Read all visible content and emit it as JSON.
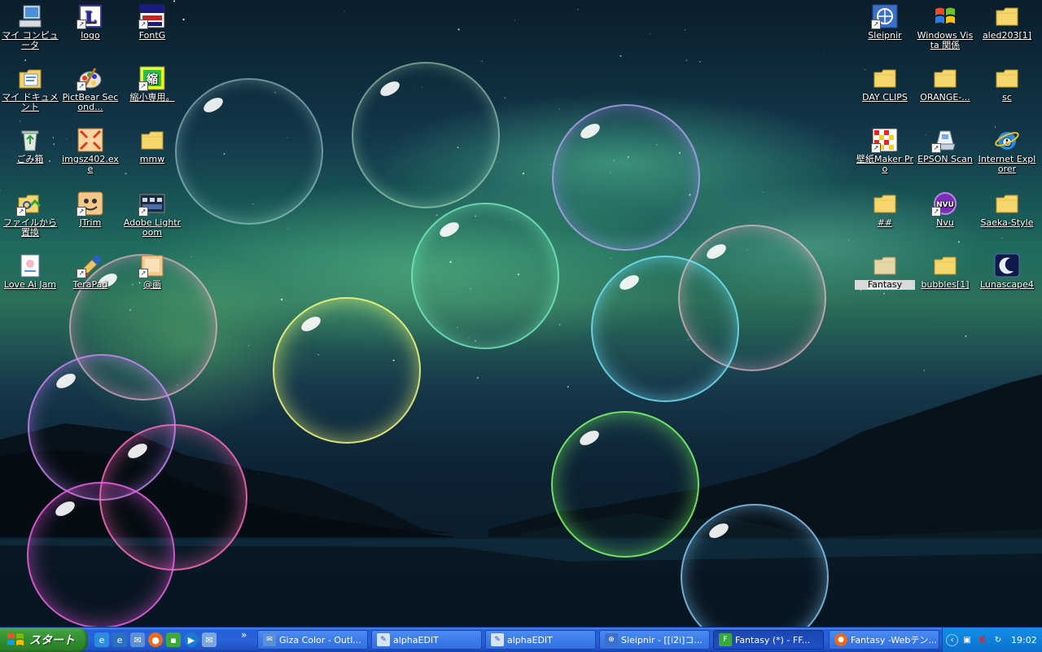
{
  "desktop": {
    "icons_left": [
      {
        "label": "マイ コンピュータ",
        "icon": "my-computer-icon"
      },
      {
        "label": "logo",
        "icon": "logo-file-icon"
      },
      {
        "label": "FontG",
        "icon": "fontg-icon"
      },
      {
        "label": "マイ ドキュメント",
        "icon": "my-documents-icon"
      },
      {
        "label": "PictBear Second...",
        "icon": "pictbear-icon"
      },
      {
        "label": "縮小専用。",
        "icon": "shukusho-icon"
      },
      {
        "label": "ごみ箱",
        "icon": "recycle-bin-icon"
      },
      {
        "label": "imgsz402.exe",
        "icon": "imgsz-icon"
      },
      {
        "label": "mmw",
        "icon": "folder-icon"
      },
      {
        "label": "ファイルから置換",
        "icon": "file-replace-icon"
      },
      {
        "label": "JTrim",
        "icon": "jtrim-icon"
      },
      {
        "label": "Adobe Lightroom",
        "icon": "lightroom-icon"
      },
      {
        "label": "Love Ai Jam",
        "icon": "love-ai-jam-icon"
      },
      {
        "label": "TeraPad",
        "icon": "terapad-icon"
      },
      {
        "label": "@画",
        "icon": "folder-image-icon"
      }
    ],
    "icons_right": [
      {
        "label": "Sleipnir",
        "icon": "sleipnir-icon"
      },
      {
        "label": "Windows Vista 関係",
        "icon": "windows-vista-icon"
      },
      {
        "label": "aled203[1]",
        "icon": "folder-icon"
      },
      {
        "label": "DAY CLIPS",
        "icon": "folder-icon"
      },
      {
        "label": "ORANGE-...",
        "icon": "folder-icon"
      },
      {
        "label": "sc",
        "icon": "folder-icon"
      },
      {
        "label": "壁紙Maker Pro",
        "icon": "wallpaper-maker-icon"
      },
      {
        "label": "EPSON Scan",
        "icon": "epson-scan-icon"
      },
      {
        "label": "Internet Explorer",
        "icon": "internet-explorer-icon"
      },
      {
        "label": "##",
        "icon": "folder-icon"
      },
      {
        "label": "Nvu",
        "icon": "nvu-icon"
      },
      {
        "label": "Saeka-Style",
        "icon": "folder-icon"
      },
      {
        "label": "Fantasy",
        "icon": "folder-icon"
      },
      {
        "label": "bubbles[1]",
        "icon": "folder-icon"
      },
      {
        "label": "Lunascape4",
        "icon": "lunascape-icon"
      }
    ]
  },
  "taskbar": {
    "start_label": "スタート",
    "overflow_label": "»",
    "quick_launch": [
      "ie-icon",
      "ie-refresh-icon",
      "outlook-icon",
      "firefox-icon",
      "app-icon",
      "media-player-icon",
      "outlook-express-icon"
    ],
    "tasks": [
      {
        "label": "Giza Color - Outl...",
        "icon": "outlook-icon",
        "active": false
      },
      {
        "label": "alphaEDIT",
        "icon": "alphaedit-icon",
        "active": false
      },
      {
        "label": "alphaEDIT",
        "icon": "alphaedit-icon",
        "active": false
      },
      {
        "label": "Sleipnir - [[i2i]コ...",
        "icon": "sleipnir-icon",
        "active": false
      },
      {
        "label": "Fantasy (*) - FF...",
        "icon": "ffftp-icon",
        "active": true
      },
      {
        "label": "Fantasy -Webテン...",
        "icon": "firefox-icon",
        "active": false
      }
    ],
    "clock": "19:02"
  },
  "colors": {
    "start_green": "#3c9b3a",
    "taskbar_blue": "#245edb",
    "tray_blue": "#0f81dc"
  }
}
